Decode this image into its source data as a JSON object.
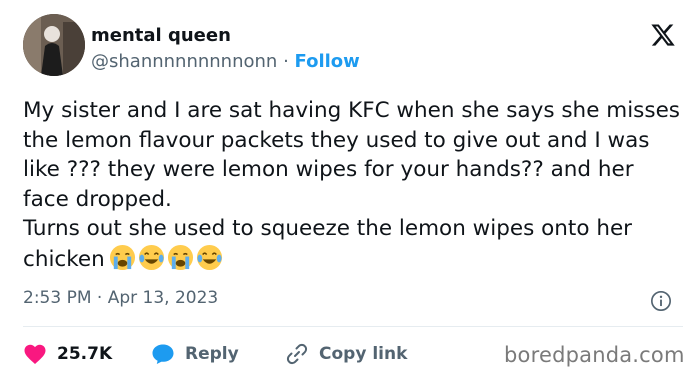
{
  "author": {
    "name": "mental queen",
    "handle": "@shannnnnnnnnonn",
    "separator": "·",
    "follow_label": "Follow"
  },
  "tweet": {
    "text": "My sister and I are sat having KFC when she says she misses the lemon flavour packets they used to give out and I was like ??? they were lemon wipes for your hands?? and her face dropped.\nTurns out she used to squeeze the lemon wipes onto her chicken",
    "emojis": [
      "crying-face-icon",
      "laughing-tears-icon",
      "crying-face-icon",
      "laughing-tears-icon"
    ]
  },
  "meta": {
    "time": "2:53 PM",
    "separator": "·",
    "date": "Apr 13, 2023"
  },
  "actions": {
    "likes_count": "25.7K",
    "reply_label": "Reply",
    "copy_label": "Copy link"
  },
  "watermark": "boredpanda.com",
  "colors": {
    "accent": "#1d9bf0",
    "like": "#f91880",
    "muted": "#536471",
    "text": "#0f1419"
  }
}
